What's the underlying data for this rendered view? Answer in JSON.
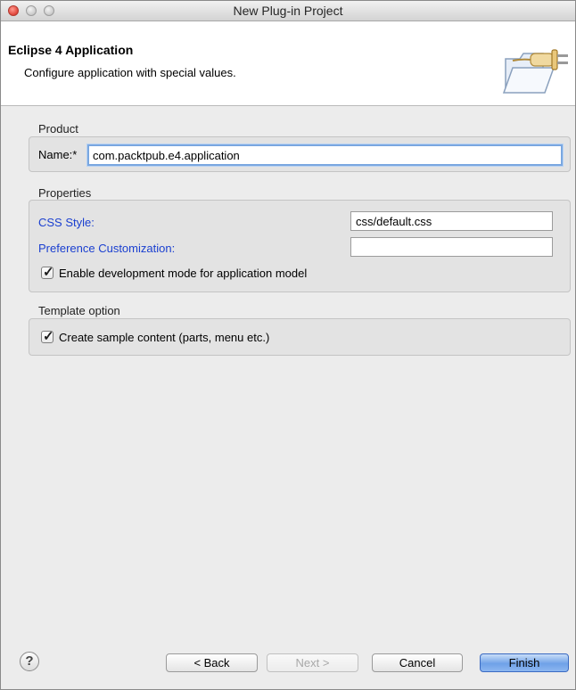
{
  "window": {
    "title": "New Plug-in Project"
  },
  "banner": {
    "title": "Eclipse 4 Application",
    "description": "Configure application with special values.",
    "icon": "plug-folder-icon"
  },
  "product": {
    "section_label": "Product",
    "name_label": "Name:*",
    "name_value": "com.packtpub.e4.application"
  },
  "properties": {
    "section_label": "Properties",
    "css_style_label": "CSS Style:",
    "css_style_value": "css/default.css",
    "pref_customization_label": "Preference Customization:",
    "pref_customization_value": "",
    "dev_mode_label": "Enable development mode for application model",
    "dev_mode_checked": true
  },
  "template": {
    "section_label": "Template option",
    "sample_content_label": "Create sample content (parts, menu etc.)",
    "sample_content_checked": true
  },
  "footer": {
    "help_glyph": "?",
    "back_label": "< Back",
    "next_label": "Next >",
    "cancel_label": "Cancel",
    "finish_label": "Finish"
  },
  "colors": {
    "link": "#1a3fd0",
    "focus_ring": "#7aa7e0",
    "default_button": "#6fa1e8"
  }
}
